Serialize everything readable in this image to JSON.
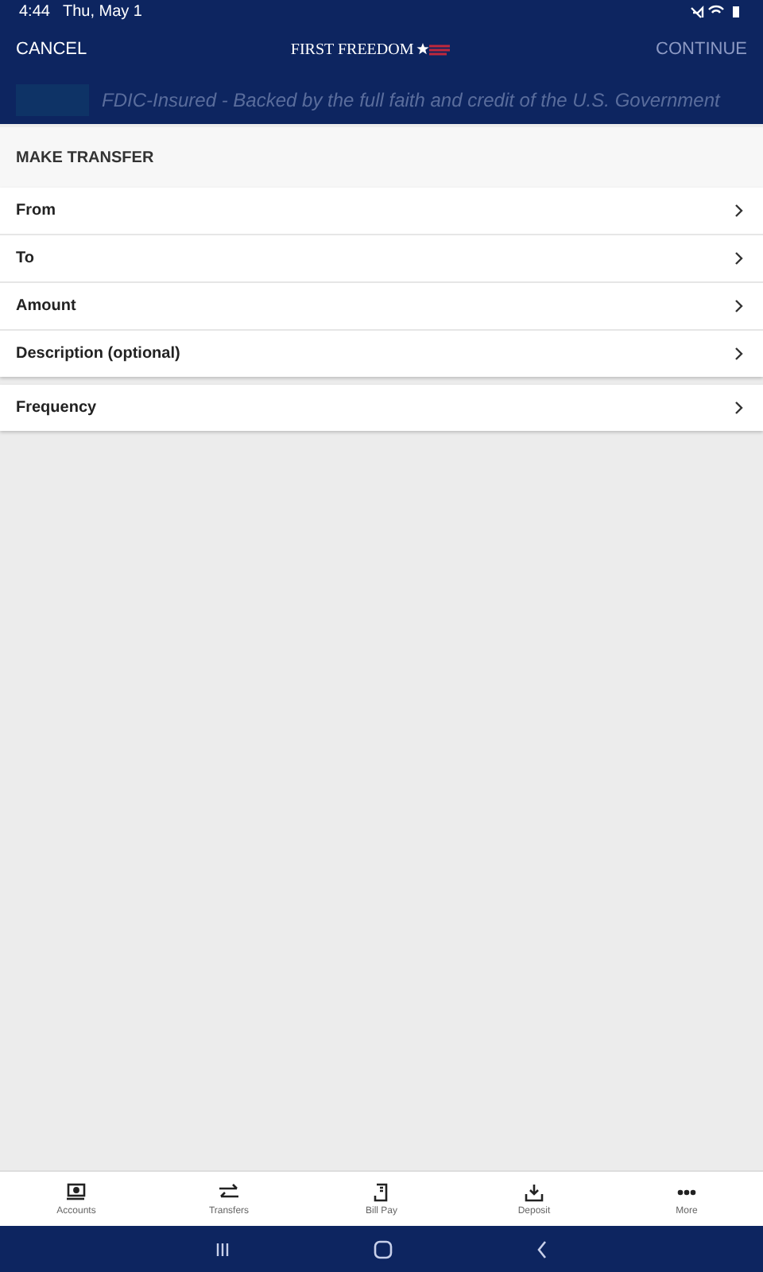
{
  "status_bar": {
    "time": "4:44",
    "date": "Thu, May 1"
  },
  "header": {
    "cancel": "CANCEL",
    "logo": "FIRST FREEDOM",
    "continue": "CONTINUE",
    "continue_disabled": true
  },
  "banner": {
    "text": "FDIC-Insured - Backed by the full faith and credit of the U.S. Government"
  },
  "section_title": "MAKE TRANSFER",
  "groups": [
    {
      "rows": [
        {
          "label": "From"
        },
        {
          "label": "To"
        },
        {
          "label": "Amount"
        },
        {
          "label": "Description (optional)"
        }
      ]
    },
    {
      "rows": [
        {
          "label": "Frequency"
        }
      ]
    }
  ],
  "bottom_nav": [
    {
      "kind": "accounts",
      "label": "Accounts"
    },
    {
      "kind": "transfers",
      "label": "Transfers"
    },
    {
      "kind": "billpay",
      "label": "Bill Pay"
    },
    {
      "kind": "deposit",
      "label": "Deposit"
    },
    {
      "kind": "more",
      "label": "More"
    }
  ]
}
